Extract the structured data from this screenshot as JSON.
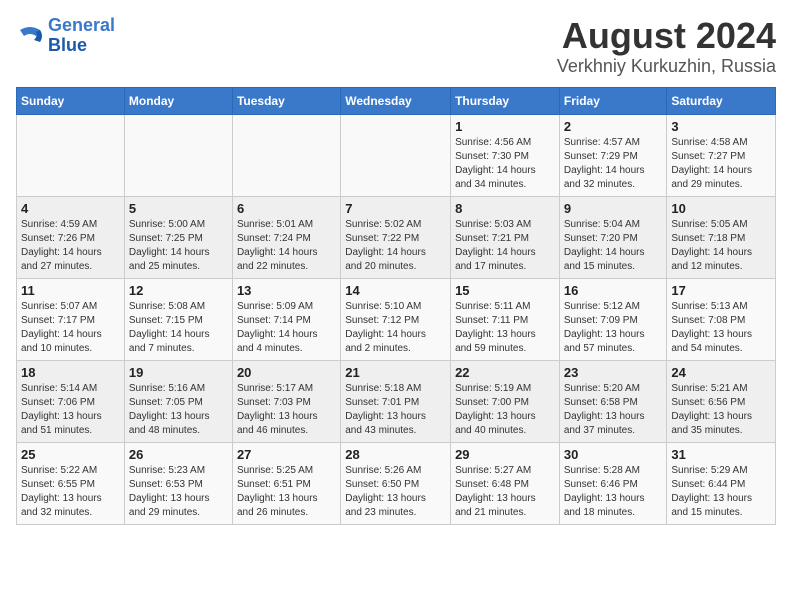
{
  "header": {
    "logo_line1": "General",
    "logo_line2": "Blue",
    "title": "August 2024",
    "subtitle": "Verkhniy Kurkuzhin, Russia"
  },
  "weekdays": [
    "Sunday",
    "Monday",
    "Tuesday",
    "Wednesday",
    "Thursday",
    "Friday",
    "Saturday"
  ],
  "weeks": [
    [
      {
        "day": "",
        "info": ""
      },
      {
        "day": "",
        "info": ""
      },
      {
        "day": "",
        "info": ""
      },
      {
        "day": "",
        "info": ""
      },
      {
        "day": "1",
        "info": "Sunrise: 4:56 AM\nSunset: 7:30 PM\nDaylight: 14 hours\nand 34 minutes."
      },
      {
        "day": "2",
        "info": "Sunrise: 4:57 AM\nSunset: 7:29 PM\nDaylight: 14 hours\nand 32 minutes."
      },
      {
        "day": "3",
        "info": "Sunrise: 4:58 AM\nSunset: 7:27 PM\nDaylight: 14 hours\nand 29 minutes."
      }
    ],
    [
      {
        "day": "4",
        "info": "Sunrise: 4:59 AM\nSunset: 7:26 PM\nDaylight: 14 hours\nand 27 minutes."
      },
      {
        "day": "5",
        "info": "Sunrise: 5:00 AM\nSunset: 7:25 PM\nDaylight: 14 hours\nand 25 minutes."
      },
      {
        "day": "6",
        "info": "Sunrise: 5:01 AM\nSunset: 7:24 PM\nDaylight: 14 hours\nand 22 minutes."
      },
      {
        "day": "7",
        "info": "Sunrise: 5:02 AM\nSunset: 7:22 PM\nDaylight: 14 hours\nand 20 minutes."
      },
      {
        "day": "8",
        "info": "Sunrise: 5:03 AM\nSunset: 7:21 PM\nDaylight: 14 hours\nand 17 minutes."
      },
      {
        "day": "9",
        "info": "Sunrise: 5:04 AM\nSunset: 7:20 PM\nDaylight: 14 hours\nand 15 minutes."
      },
      {
        "day": "10",
        "info": "Sunrise: 5:05 AM\nSunset: 7:18 PM\nDaylight: 14 hours\nand 12 minutes."
      }
    ],
    [
      {
        "day": "11",
        "info": "Sunrise: 5:07 AM\nSunset: 7:17 PM\nDaylight: 14 hours\nand 10 minutes."
      },
      {
        "day": "12",
        "info": "Sunrise: 5:08 AM\nSunset: 7:15 PM\nDaylight: 14 hours\nand 7 minutes."
      },
      {
        "day": "13",
        "info": "Sunrise: 5:09 AM\nSunset: 7:14 PM\nDaylight: 14 hours\nand 4 minutes."
      },
      {
        "day": "14",
        "info": "Sunrise: 5:10 AM\nSunset: 7:12 PM\nDaylight: 14 hours\nand 2 minutes."
      },
      {
        "day": "15",
        "info": "Sunrise: 5:11 AM\nSunset: 7:11 PM\nDaylight: 13 hours\nand 59 minutes."
      },
      {
        "day": "16",
        "info": "Sunrise: 5:12 AM\nSunset: 7:09 PM\nDaylight: 13 hours\nand 57 minutes."
      },
      {
        "day": "17",
        "info": "Sunrise: 5:13 AM\nSunset: 7:08 PM\nDaylight: 13 hours\nand 54 minutes."
      }
    ],
    [
      {
        "day": "18",
        "info": "Sunrise: 5:14 AM\nSunset: 7:06 PM\nDaylight: 13 hours\nand 51 minutes."
      },
      {
        "day": "19",
        "info": "Sunrise: 5:16 AM\nSunset: 7:05 PM\nDaylight: 13 hours\nand 48 minutes."
      },
      {
        "day": "20",
        "info": "Sunrise: 5:17 AM\nSunset: 7:03 PM\nDaylight: 13 hours\nand 46 minutes."
      },
      {
        "day": "21",
        "info": "Sunrise: 5:18 AM\nSunset: 7:01 PM\nDaylight: 13 hours\nand 43 minutes."
      },
      {
        "day": "22",
        "info": "Sunrise: 5:19 AM\nSunset: 7:00 PM\nDaylight: 13 hours\nand 40 minutes."
      },
      {
        "day": "23",
        "info": "Sunrise: 5:20 AM\nSunset: 6:58 PM\nDaylight: 13 hours\nand 37 minutes."
      },
      {
        "day": "24",
        "info": "Sunrise: 5:21 AM\nSunset: 6:56 PM\nDaylight: 13 hours\nand 35 minutes."
      }
    ],
    [
      {
        "day": "25",
        "info": "Sunrise: 5:22 AM\nSunset: 6:55 PM\nDaylight: 13 hours\nand 32 minutes."
      },
      {
        "day": "26",
        "info": "Sunrise: 5:23 AM\nSunset: 6:53 PM\nDaylight: 13 hours\nand 29 minutes."
      },
      {
        "day": "27",
        "info": "Sunrise: 5:25 AM\nSunset: 6:51 PM\nDaylight: 13 hours\nand 26 minutes."
      },
      {
        "day": "28",
        "info": "Sunrise: 5:26 AM\nSunset: 6:50 PM\nDaylight: 13 hours\nand 23 minutes."
      },
      {
        "day": "29",
        "info": "Sunrise: 5:27 AM\nSunset: 6:48 PM\nDaylight: 13 hours\nand 21 minutes."
      },
      {
        "day": "30",
        "info": "Sunrise: 5:28 AM\nSunset: 6:46 PM\nDaylight: 13 hours\nand 18 minutes."
      },
      {
        "day": "31",
        "info": "Sunrise: 5:29 AM\nSunset: 6:44 PM\nDaylight: 13 hours\nand 15 minutes."
      }
    ]
  ]
}
